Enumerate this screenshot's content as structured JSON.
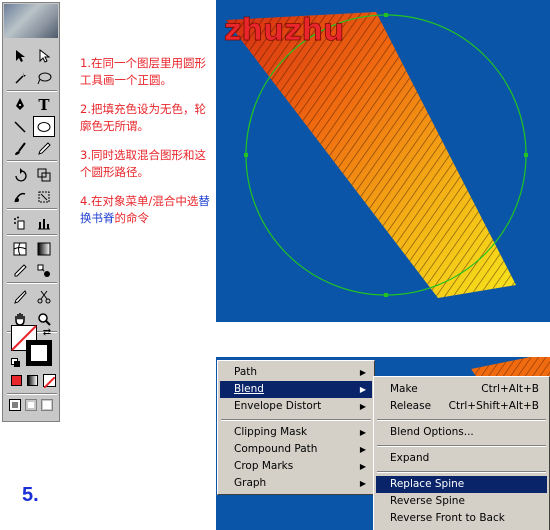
{
  "notes": {
    "n1": "1.在同一个图层里用圆形工具画一个正圆。",
    "n2": "2.把填充色设为无色，轮廓色无所谓。",
    "n3": "3.同时选取混合图形和这个圆形路径。",
    "n4_pre": "4.在对象菜单/混合中选",
    "n4_hl": "替换书脊",
    "n4_post": "的命令"
  },
  "step_label": "5.",
  "artwork_text": "zhuzhu",
  "colors": {
    "canvas": "#0a55a8",
    "text": "#e8262b",
    "highlight": "#1f3fd0",
    "menu_highlight": "#0a246a",
    "circle": "#22c422"
  },
  "menu": {
    "items": [
      {
        "label": "Path",
        "arrow": "▶"
      },
      {
        "label": "Blend",
        "arrow": "▶"
      },
      {
        "label": "Envelope Distort",
        "arrow": "▶"
      },
      {
        "label": "Clipping Mask",
        "arrow": "▶"
      },
      {
        "label": "Compound Path",
        "arrow": "▶"
      },
      {
        "label": "Crop Marks",
        "arrow": "▶"
      },
      {
        "label": "Graph",
        "arrow": "▶"
      }
    ]
  },
  "submenu": {
    "items": [
      {
        "label": "Make",
        "shortcut": "Ctrl+Alt+B"
      },
      {
        "label": "Release",
        "shortcut": "Ctrl+Shift+Alt+B"
      },
      {
        "label": "Blend Options...",
        "shortcut": ""
      },
      {
        "label": "Expand",
        "shortcut": ""
      },
      {
        "label": "Replace Spine",
        "shortcut": ""
      },
      {
        "label": "Reverse Spine",
        "shortcut": ""
      },
      {
        "label": "Reverse Front to Back",
        "shortcut": ""
      }
    ]
  },
  "tools": [
    "selection-tool-icon",
    "direct-selection-tool-icon",
    "magic-wand-tool-icon",
    "lasso-tool-icon",
    "pen-tool-icon",
    "type-tool-icon",
    "line-tool-icon",
    "ellipse-tool-icon",
    "paintbrush-tool-icon",
    "pencil-tool-icon",
    "rotate-tool-icon",
    "scale-tool-icon",
    "warp-tool-icon",
    "free-transform-tool-icon",
    "symbol-sprayer-tool-icon",
    "graph-tool-icon",
    "mesh-tool-icon",
    "gradient-tool-icon",
    "eyedropper-tool-icon",
    "blend-tool-icon",
    "scissors-tool-icon",
    "slice-tool-icon",
    "hand-tool-icon",
    "zoom-tool-icon"
  ]
}
